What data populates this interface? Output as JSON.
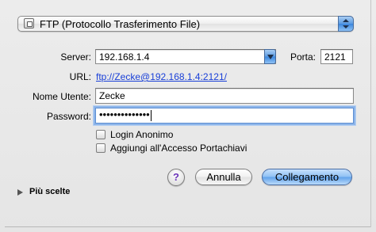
{
  "protocol": {
    "selected": "FTP (Protocollo Trasferimento File)",
    "icon": "file-server-icon"
  },
  "form": {
    "server_label": "Server:",
    "server_value": "192.168.1.4",
    "port_label": "Porta:",
    "port_value": "2121",
    "url_label": "URL:",
    "url_value": "ftp://Zecke@192.168.1.4:2121/",
    "username_label": "Nome Utente:",
    "username_value": "Zecke",
    "password_label": "Password:",
    "password_mask": "••••••••••••••"
  },
  "options": {
    "anonymous_login": {
      "label": "Login Anonimo",
      "checked": false
    },
    "add_to_keychain": {
      "label": "Aggiungi all'Accesso Portachiavi",
      "checked": false
    }
  },
  "buttons": {
    "help": "?",
    "cancel": "Annulla",
    "connect": "Collegamento"
  },
  "disclosure": {
    "label": "Più scelte"
  },
  "colors": {
    "link": "#1a40d8",
    "accent_blue": "#5fa1ea",
    "help_purple": "#6a34b8"
  }
}
